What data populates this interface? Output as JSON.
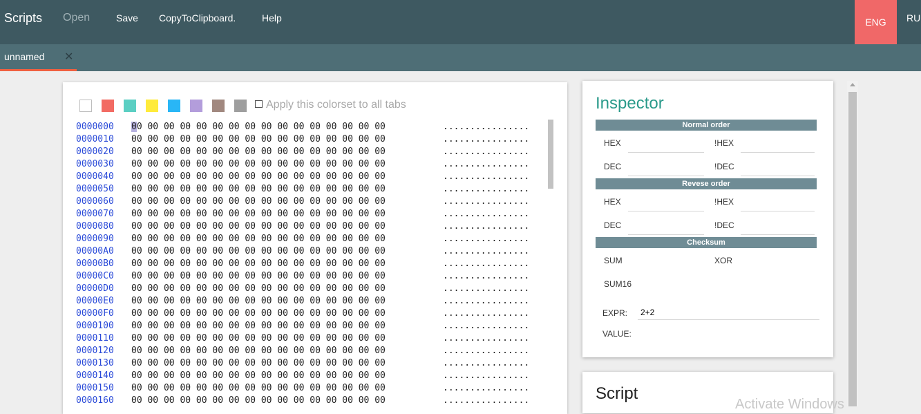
{
  "topbar": {
    "brand": "Scripts",
    "menu": [
      "Open",
      "Save",
      "CopyToClipboard.",
      "Help"
    ],
    "lang_active": "ENG",
    "lang_other": "RU"
  },
  "tabs": [
    {
      "label": "unnamed",
      "close": "✕"
    }
  ],
  "hex": {
    "colors": [
      "#ffffff",
      "#f26b63",
      "#5bcfc3",
      "#ffeb3b",
      "#29b6f6",
      "#b39ddb",
      "#a1887f",
      "#9e9e9e"
    ],
    "apply_label": "Apply this colorset to all tabs",
    "lines": [
      {
        "offset": "0000000",
        "bytes": "00 00 00 00 00 00 00 00 00 00 00 00 00 00 00 00",
        "ascii": "................"
      },
      {
        "offset": "0000010",
        "bytes": "00 00 00 00 00 00 00 00 00 00 00 00 00 00 00 00",
        "ascii": "................"
      },
      {
        "offset": "0000020",
        "bytes": "00 00 00 00 00 00 00 00 00 00 00 00 00 00 00 00",
        "ascii": "................"
      },
      {
        "offset": "0000030",
        "bytes": "00 00 00 00 00 00 00 00 00 00 00 00 00 00 00 00",
        "ascii": "................"
      },
      {
        "offset": "0000040",
        "bytes": "00 00 00 00 00 00 00 00 00 00 00 00 00 00 00 00",
        "ascii": "................"
      },
      {
        "offset": "0000050",
        "bytes": "00 00 00 00 00 00 00 00 00 00 00 00 00 00 00 00",
        "ascii": "................"
      },
      {
        "offset": "0000060",
        "bytes": "00 00 00 00 00 00 00 00 00 00 00 00 00 00 00 00",
        "ascii": "................"
      },
      {
        "offset": "0000070",
        "bytes": "00 00 00 00 00 00 00 00 00 00 00 00 00 00 00 00",
        "ascii": "................"
      },
      {
        "offset": "0000080",
        "bytes": "00 00 00 00 00 00 00 00 00 00 00 00 00 00 00 00",
        "ascii": "................"
      },
      {
        "offset": "0000090",
        "bytes": "00 00 00 00 00 00 00 00 00 00 00 00 00 00 00 00",
        "ascii": "................"
      },
      {
        "offset": "00000A0",
        "bytes": "00 00 00 00 00 00 00 00 00 00 00 00 00 00 00 00",
        "ascii": "................"
      },
      {
        "offset": "00000B0",
        "bytes": "00 00 00 00 00 00 00 00 00 00 00 00 00 00 00 00",
        "ascii": "................"
      },
      {
        "offset": "00000C0",
        "bytes": "00 00 00 00 00 00 00 00 00 00 00 00 00 00 00 00",
        "ascii": "................"
      },
      {
        "offset": "00000D0",
        "bytes": "00 00 00 00 00 00 00 00 00 00 00 00 00 00 00 00",
        "ascii": "................"
      },
      {
        "offset": "00000E0",
        "bytes": "00 00 00 00 00 00 00 00 00 00 00 00 00 00 00 00",
        "ascii": "................"
      },
      {
        "offset": "00000F0",
        "bytes": "00 00 00 00 00 00 00 00 00 00 00 00 00 00 00 00",
        "ascii": "................"
      },
      {
        "offset": "0000100",
        "bytes": "00 00 00 00 00 00 00 00 00 00 00 00 00 00 00 00",
        "ascii": "................"
      },
      {
        "offset": "0000110",
        "bytes": "00 00 00 00 00 00 00 00 00 00 00 00 00 00 00 00",
        "ascii": "................"
      },
      {
        "offset": "0000120",
        "bytes": "00 00 00 00 00 00 00 00 00 00 00 00 00 00 00 00",
        "ascii": "................"
      },
      {
        "offset": "0000130",
        "bytes": "00 00 00 00 00 00 00 00 00 00 00 00 00 00 00 00",
        "ascii": "................"
      },
      {
        "offset": "0000140",
        "bytes": "00 00 00 00 00 00 00 00 00 00 00 00 00 00 00 00",
        "ascii": "................"
      },
      {
        "offset": "0000150",
        "bytes": "00 00 00 00 00 00 00 00 00 00 00 00 00 00 00 00",
        "ascii": "................"
      },
      {
        "offset": "0000160",
        "bytes": "00 00 00 00 00 00 00 00 00 00 00 00 00 00 00 00",
        "ascii": "................"
      }
    ]
  },
  "inspector": {
    "title": "Inspector",
    "normal_order": {
      "header": "Normal order",
      "hex": "HEX",
      "nhex": "!HEX",
      "dec": "DEC",
      "ndec": "!DEC"
    },
    "reverse_order": {
      "header": "Revese order",
      "hex": "HEX",
      "nhex": "!HEX",
      "dec": "DEC",
      "ndec": "!DEC"
    },
    "checksum": {
      "header": "Checksum",
      "sum": "SUM",
      "xor": "XOR",
      "sum16": "SUM16"
    },
    "expr_label": "EXPR:",
    "expr_value": "2+2",
    "value_label": "VALUE:"
  },
  "script": {
    "title": "Script"
  },
  "watermark": "Activate Windows"
}
